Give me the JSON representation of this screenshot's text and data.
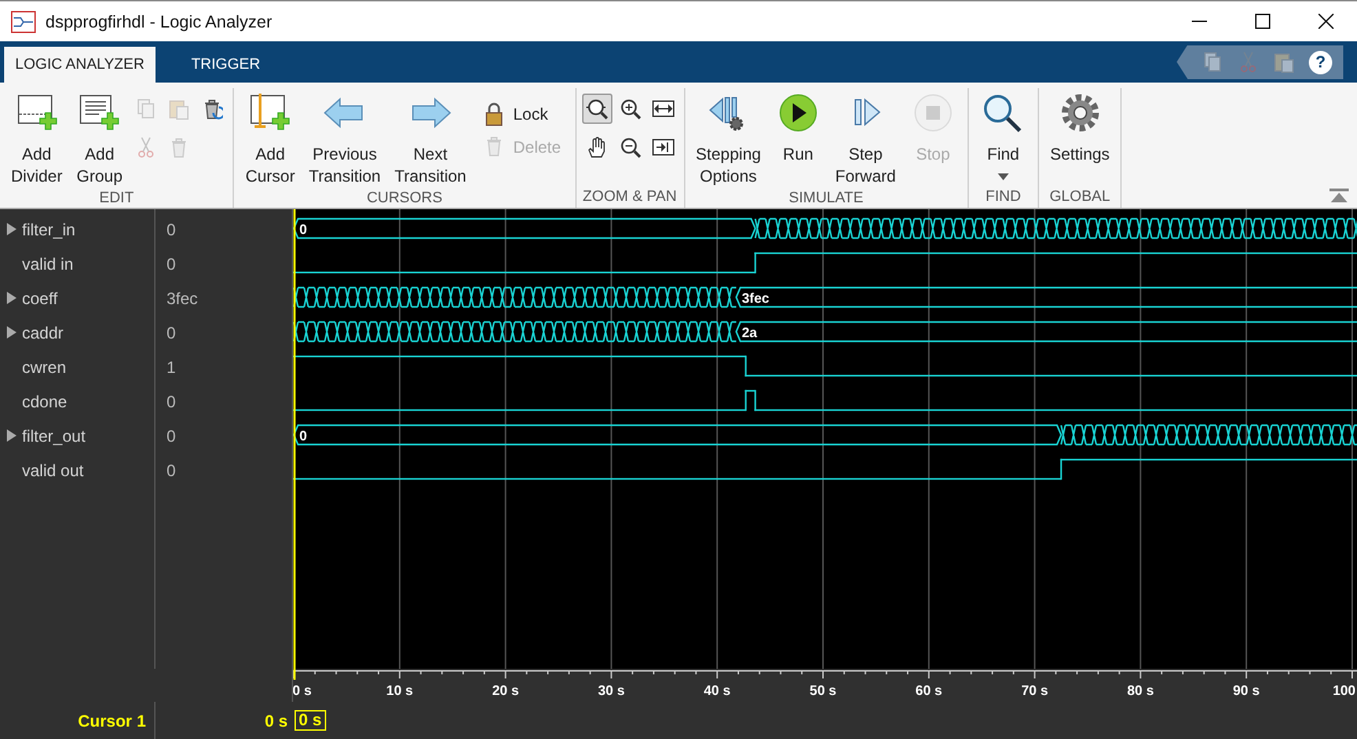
{
  "window": {
    "title": "dspprogfirhdl - Logic Analyzer"
  },
  "tabs": [
    {
      "label": "LOGIC ANALYZER",
      "selected": true
    },
    {
      "label": "TRIGGER",
      "selected": false
    }
  ],
  "quick_access": {
    "help": "?"
  },
  "toolbar": {
    "groups": [
      {
        "label": "EDIT",
        "items": [
          {
            "kind": "large",
            "label": "Add\nDivider",
            "disabled": false
          },
          {
            "kind": "large",
            "label": "Add\nGroup",
            "disabled": false
          },
          {
            "kind": "icon_grid",
            "buttons": [
              {
                "disabled": true
              },
              {
                "disabled": true
              },
              {
                "disabled": false
              },
              {
                "disabled": true
              },
              {
                "disabled": true
              }
            ]
          }
        ]
      },
      {
        "label": "CURSORS",
        "items": [
          {
            "kind": "large",
            "label": "Add\nCursor",
            "disabled": false
          },
          {
            "kind": "large",
            "label": "Previous\nTransition",
            "disabled": false
          },
          {
            "kind": "large",
            "label": "Next\nTransition",
            "disabled": false
          },
          {
            "kind": "stack",
            "buttons": [
              {
                "label": "Lock",
                "disabled": false
              },
              {
                "label": "Delete",
                "disabled": true
              }
            ]
          }
        ]
      },
      {
        "label": "ZOOM & PAN",
        "items": [
          {
            "kind": "toggle_grid",
            "buttons": [
              {
                "selected": true
              },
              {
                "selected": false
              },
              {
                "selected": false
              },
              {
                "selected": false
              },
              {
                "selected": false
              },
              {
                "selected": false
              }
            ]
          }
        ]
      },
      {
        "label": "SIMULATE",
        "items": [
          {
            "kind": "large",
            "label": "Stepping\nOptions",
            "disabled": false
          },
          {
            "kind": "large",
            "label": "Run",
            "disabled": false
          },
          {
            "kind": "large",
            "label": "Step\nForward",
            "disabled": false
          },
          {
            "kind": "large",
            "label": "Stop",
            "disabled": true
          }
        ]
      },
      {
        "label": "FIND",
        "items": [
          {
            "kind": "large",
            "label": "Find",
            "disabled": false,
            "dropdown": true
          }
        ]
      },
      {
        "label": "GLOBAL",
        "items": [
          {
            "kind": "large",
            "label": "Settings",
            "disabled": false
          }
        ]
      }
    ]
  },
  "signals": [
    {
      "name": "filter_in",
      "expanded": false,
      "value": "0",
      "kind": "bus",
      "segments": [
        {
          "kind": "steady",
          "label": "0"
        },
        {
          "kind": "toggling"
        }
      ]
    },
    {
      "name": "valid in",
      "value": "0",
      "kind": "bit",
      "steps": [
        {
          "high": false
        },
        {
          "high": true
        }
      ]
    },
    {
      "name": "coeff",
      "expanded": false,
      "value": "3fec",
      "kind": "bus",
      "segments": [
        {
          "kind": "toggling"
        },
        {
          "kind": "steady",
          "label": "3fec"
        }
      ]
    },
    {
      "name": "caddr",
      "expanded": false,
      "value": "0",
      "kind": "bus",
      "segments": [
        {
          "kind": "toggling"
        },
        {
          "kind": "steady",
          "label": "2a"
        }
      ]
    },
    {
      "name": "cwren",
      "value": "1",
      "kind": "bit",
      "steps": [
        {
          "high": true
        },
        {
          "high": false
        }
      ]
    },
    {
      "name": "cdone",
      "value": "0",
      "kind": "bit",
      "steps": [
        {
          "high": false
        },
        {
          "high": true
        },
        {
          "high": false
        }
      ]
    },
    {
      "name": "filter_out",
      "expanded": false,
      "value": "0",
      "kind": "bus",
      "segments": [
        {
          "kind": "steady",
          "label": "0"
        },
        {
          "kind": "toggling"
        }
      ]
    },
    {
      "name": "valid out",
      "value": "0",
      "kind": "bit",
      "steps": [
        {
          "high": false
        },
        {
          "high": true
        }
      ]
    }
  ],
  "axis": {
    "ticks": [
      "0 s",
      "10 s",
      "20 s",
      "30 s",
      "40 s",
      "50 s",
      "60 s",
      "70 s",
      "80 s",
      "90 s",
      "100"
    ]
  },
  "cursors": [
    {
      "name": "Cursor 1",
      "value": "0 s",
      "marker": "0 s"
    }
  ]
}
